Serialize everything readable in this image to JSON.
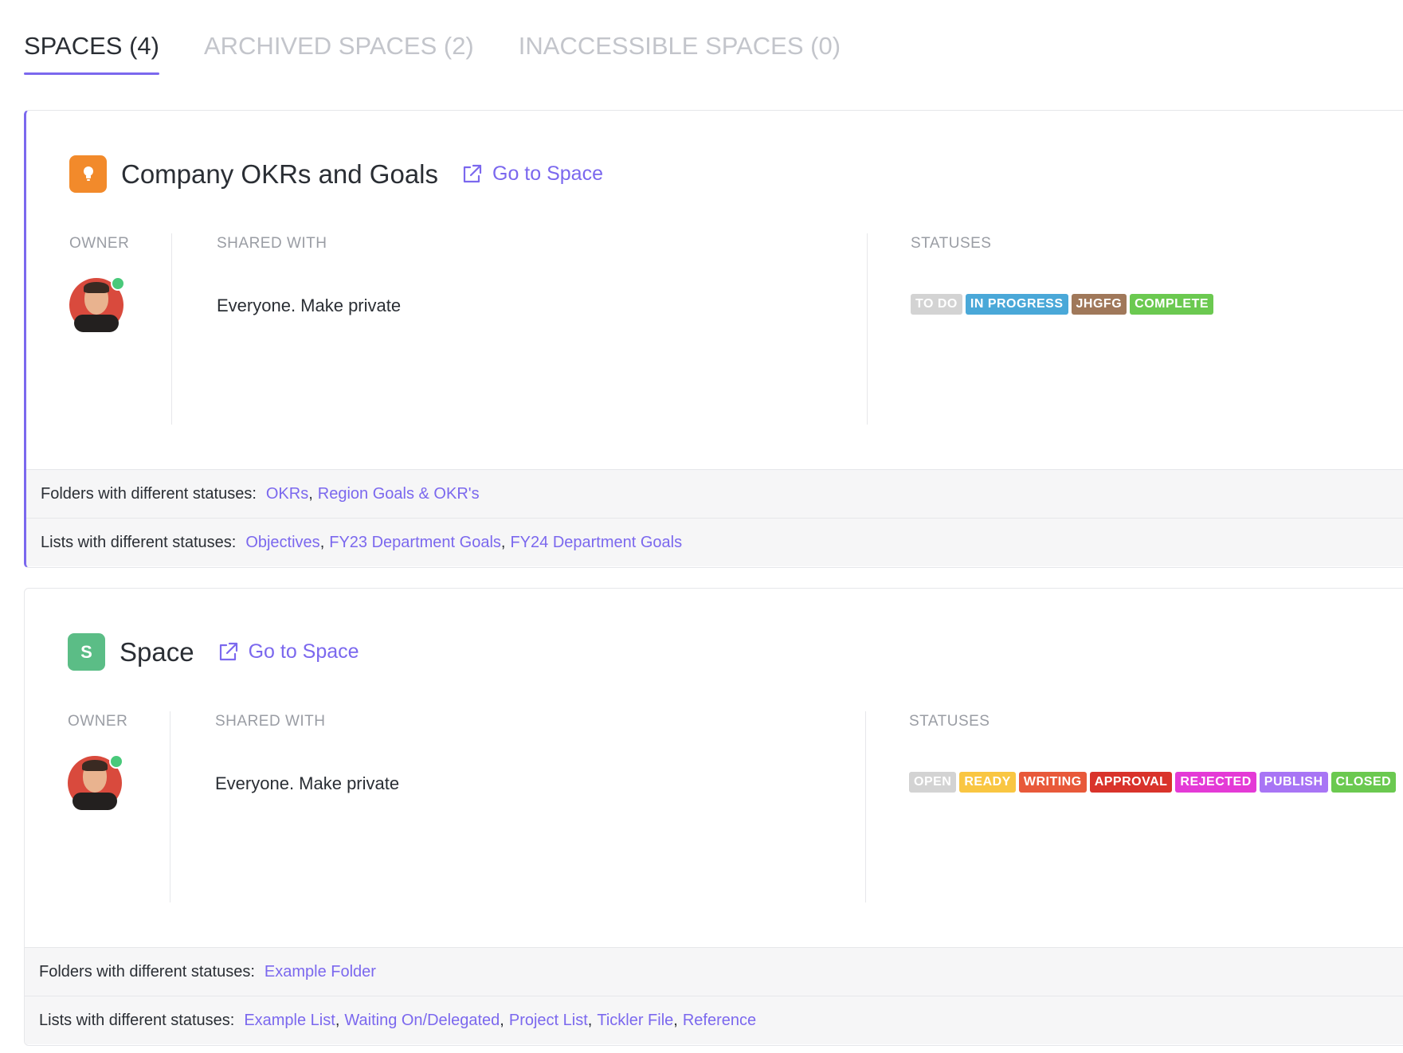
{
  "tabs": [
    {
      "label": "SPACES (4)",
      "active": true
    },
    {
      "label": "ARCHIVED SPACES (2)",
      "active": false
    },
    {
      "label": "INACCESSIBLE SPACES (0)",
      "active": false
    }
  ],
  "labels": {
    "owner": "OWNER",
    "shared_with": "SHARED WITH",
    "statuses": "STATUSES"
  },
  "colors": {
    "accent": "#7b68ee",
    "online": "#49c97a"
  },
  "spaces": [
    {
      "name": "Company OKRs and Goals",
      "icon": "lightbulb-icon",
      "icon_color": "#f28a2b",
      "go_to": "Go to Space",
      "shared": "Everyone. Make private",
      "statuses": [
        {
          "label": "TO DO",
          "color": "#d3d3d3"
        },
        {
          "label": "IN PROGRESS",
          "color": "#4aa8d8"
        },
        {
          "label": "JHGFG",
          "color": "#a0785a"
        },
        {
          "label": "COMPLETE",
          "color": "#6bc950"
        }
      ],
      "folders_prefix": "Folders with different statuses:",
      "folders": [
        "OKRs",
        "Region Goals & OKR's"
      ],
      "lists_prefix": "Lists with different statuses:",
      "lists": [
        "Objectives",
        "FY23 Department Goals",
        "FY24 Department Goals"
      ]
    },
    {
      "name": "Space",
      "icon_letter": "S",
      "icon_color": "#5bbd86",
      "go_to": "Go to Space",
      "shared": "Everyone. Make private",
      "statuses": [
        {
          "label": "OPEN",
          "color": "#d3d3d3"
        },
        {
          "label": "READY",
          "color": "#f9c642"
        },
        {
          "label": "WRITING",
          "color": "#e8593a"
        },
        {
          "label": "APPROVAL",
          "color": "#d9332b"
        },
        {
          "label": "REJECTED",
          "color": "#e43ad6"
        },
        {
          "label": "PUBLISH",
          "color": "#a875f5"
        },
        {
          "label": "CLOSED",
          "color": "#6bc950"
        }
      ],
      "folders_prefix": "Folders with different statuses:",
      "folders": [
        "Example Folder"
      ],
      "lists_prefix": "Lists with different statuses:",
      "lists": [
        "Example List",
        "Waiting On/Delegated",
        "Project List",
        "Tickler File",
        "Reference"
      ]
    }
  ]
}
